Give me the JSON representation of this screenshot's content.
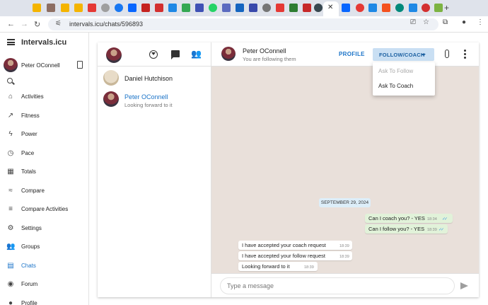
{
  "browser": {
    "url": "intervals.icu/chats/596893",
    "active_tab_close": "✕",
    "new_tab": "+"
  },
  "app": {
    "brand": "Intervals.icu",
    "user_name": "Peter OConnell"
  },
  "sidebar": {
    "items": [
      {
        "label": "Activities",
        "icon": "home-icon",
        "glyph": "⌂"
      },
      {
        "label": "Fitness",
        "icon": "trending-icon",
        "glyph": "↗"
      },
      {
        "label": "Power",
        "icon": "power-icon",
        "glyph": "ϟ"
      },
      {
        "label": "Pace",
        "icon": "watch-icon",
        "glyph": "◷"
      },
      {
        "label": "Totals",
        "icon": "calendar-icon",
        "glyph": "▦"
      },
      {
        "label": "Compare",
        "icon": "chart-line-icon",
        "glyph": "≈"
      },
      {
        "label": "Compare Activities",
        "icon": "compare-list-icon",
        "glyph": "≡"
      },
      {
        "label": "Settings",
        "icon": "gear-icon",
        "glyph": "⚙"
      },
      {
        "label": "Groups",
        "icon": "groups-icon",
        "glyph": "👥"
      },
      {
        "label": "Chats",
        "icon": "chat-icon",
        "glyph": "▤"
      },
      {
        "label": "Forum",
        "icon": "forum-icon",
        "glyph": "◉"
      },
      {
        "label": "Profile",
        "icon": "profile-icon",
        "glyph": "●"
      }
    ],
    "active": "Chats",
    "active_color": "#1a73c8"
  },
  "contacts": [
    {
      "name": "Daniel Hutchison",
      "subtitle": ""
    },
    {
      "name": "Peter OConnell",
      "subtitle": "Looking forward to it"
    }
  ],
  "chat": {
    "peer_name": "Peter OConnell",
    "peer_status": "You are following them",
    "profile_label": "PROFILE",
    "follow_label": "FOLLOW/COACH",
    "date_chip": "SEPTEMBER 29, 2024",
    "messages": [
      {
        "text": "Can I coach you? - YES",
        "time": "18:34",
        "dir": "out",
        "ticks": "✓✓"
      },
      {
        "text": "Can I follow you? - YES",
        "time": "18:39",
        "dir": "out",
        "ticks": "✓✓"
      },
      {
        "text": "I have accepted your coach request",
        "time": "18:39",
        "dir": "in"
      },
      {
        "text": "I have accepted your follow request",
        "time": "18:39",
        "dir": "in"
      },
      {
        "text": "Looking forward to it",
        "time": "18:39",
        "dir": "in"
      }
    ],
    "composer_placeholder": "Type a message",
    "bg_color": "#e9e0da",
    "outgoing_color": "#e1f2d9"
  },
  "dropdown": {
    "items": [
      {
        "label": "Ask To Follow",
        "enabled": false
      },
      {
        "label": "Ask To Coach",
        "enabled": true
      }
    ]
  }
}
